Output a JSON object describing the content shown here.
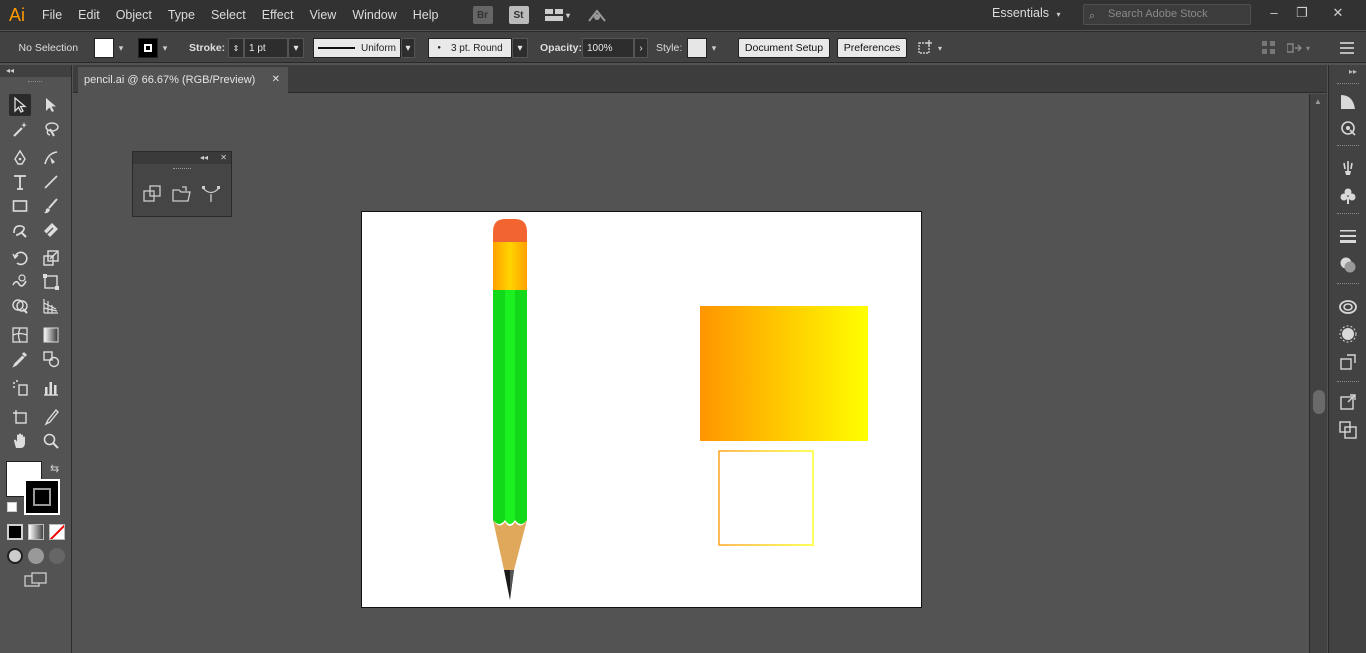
{
  "app": {
    "logo": "Ai",
    "menu": [
      "File",
      "Edit",
      "Object",
      "Type",
      "Select",
      "Effect",
      "View",
      "Window",
      "Help"
    ],
    "bridge_label": "Br",
    "stock_label": "St",
    "workspace": "Essentials",
    "search_placeholder": "Search Adobe Stock"
  },
  "control_bar": {
    "selection": "No Selection",
    "stroke_label": "Stroke:",
    "stroke_weight": "1 pt",
    "profile": "Uniform",
    "brush": "3 pt. Round",
    "opacity_label": "Opacity:",
    "opacity": "100%",
    "style_label": "Style:",
    "document_setup": "Document Setup",
    "preferences": "Preferences"
  },
  "document": {
    "tab_title": "pencil.ai @ 66.67% (RGB/Preview)"
  },
  "colors": {
    "accent_orange": "#ff9a00",
    "pencil_green": "#12d81a",
    "pencil_eraser": "#f26530",
    "ferrule_yellow": "#ffc400",
    "wood": "#e0a85a",
    "gradient_start": "#ff9500",
    "gradient_end": "#ffff00"
  },
  "tools": [
    "selection-tool",
    "direct-selection-tool",
    "magic-wand-tool",
    "lasso-tool",
    "pen-tool",
    "curvature-tool",
    "type-tool",
    "line-tool",
    "rectangle-tool",
    "paintbrush-tool",
    "shaper-tool",
    "eraser-tool",
    "rotate-tool",
    "scale-tool",
    "warp-tool",
    "free-transform-tool",
    "shape-builder-tool",
    "perspective-grid-tool",
    "mesh-tool",
    "gradient-tool",
    "eyedropper-tool",
    "blend-tool",
    "symbol-sprayer-tool",
    "column-graph-tool",
    "artboard-tool",
    "slice-tool",
    "hand-tool",
    "zoom-tool"
  ]
}
